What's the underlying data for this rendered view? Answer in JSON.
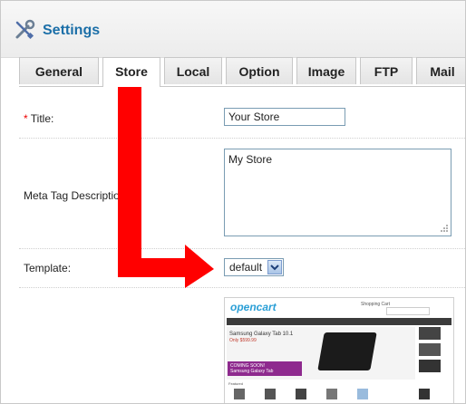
{
  "header": {
    "title": "Settings",
    "icon": "wrench-screwdriver-icon"
  },
  "tabs": [
    {
      "label": "General",
      "active": false
    },
    {
      "label": "Store",
      "active": true
    },
    {
      "label": "Local",
      "active": false
    },
    {
      "label": "Option",
      "active": false
    },
    {
      "label": "Image",
      "active": false
    },
    {
      "label": "FTP",
      "active": false
    },
    {
      "label": "Mail",
      "active": false
    }
  ],
  "form": {
    "title_required": "*",
    "title_label": " Title:",
    "title_value": "Your Store",
    "meta_label": "Meta Tag Description:",
    "meta_value": "My Store",
    "template_label": "Template:",
    "template_value": "default"
  },
  "preview": {
    "logo": "opencart",
    "cart_label": "Shopping Cart",
    "banner_title": "Samsung Galaxy Tab 10.1",
    "banner_price": "Only $599.99",
    "banner_cta_1": "COMING SOON!",
    "banner_cta_2": "Samsung Galaxy Tab",
    "featured_label": "Featured"
  },
  "annotation": {
    "arrow_color": "#ff0000"
  }
}
